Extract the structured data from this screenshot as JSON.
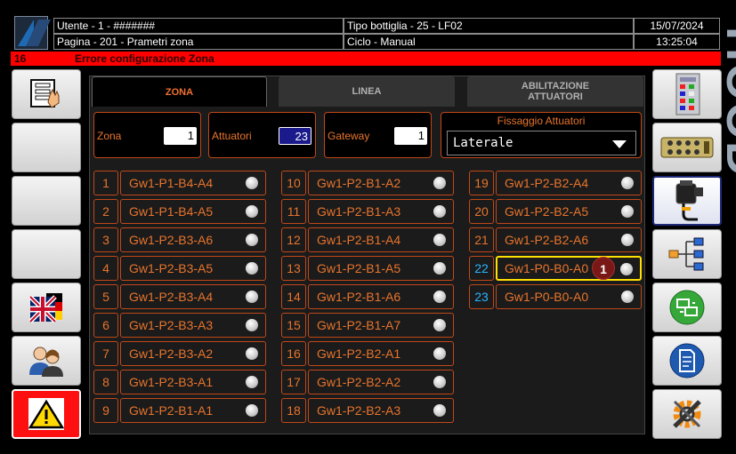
{
  "header": {
    "user": "Utente - 1 - #######",
    "bottle_type": "Tipo bottiglia - 25 - LF02",
    "date": "15/07/2024",
    "page": "Pagina - 201 - Prametri zona",
    "cycle": "Ciclo - Manual",
    "time": "13:25:04"
  },
  "error": {
    "code": "16",
    "message": "Errore configurazione Zona"
  },
  "side_text": "HOOD",
  "tabs": [
    {
      "label": "ZONA"
    },
    {
      "label": "LINEA"
    },
    {
      "label": "ABILITAZIONE ATTUATORI"
    }
  ],
  "settings": {
    "zona_label": "Zona",
    "zona_value": "1",
    "attuatori_label": "Attuatori",
    "attuatori_value": "23",
    "gateway_label": "Gateway",
    "gateway_value": "1",
    "fissaggio_label": "Fissaggio Attuatori",
    "fissaggio_value": "Laterale"
  },
  "actuators": [
    {
      "num": "1",
      "name": "Gw1-P1-B4-A4"
    },
    {
      "num": "2",
      "name": "Gw1-P1-B4-A5"
    },
    {
      "num": "3",
      "name": "Gw1-P2-B3-A6"
    },
    {
      "num": "4",
      "name": "Gw1-P2-B3-A5"
    },
    {
      "num": "5",
      "name": "Gw1-P2-B3-A4"
    },
    {
      "num": "6",
      "name": "Gw1-P2-B3-A3"
    },
    {
      "num": "7",
      "name": "Gw1-P2-B3-A2"
    },
    {
      "num": "8",
      "name": "Gw1-P2-B3-A1"
    },
    {
      "num": "9",
      "name": "Gw1-P2-B1-A1"
    },
    {
      "num": "10",
      "name": "Gw1-P2-B1-A2"
    },
    {
      "num": "11",
      "name": "Gw1-P2-B1-A3"
    },
    {
      "num": "12",
      "name": "Gw1-P2-B1-A4"
    },
    {
      "num": "13",
      "name": "Gw1-P2-B1-A5"
    },
    {
      "num": "14",
      "name": "Gw1-P2-B1-A6"
    },
    {
      "num": "15",
      "name": "Gw1-P2-B1-A7"
    },
    {
      "num": "16",
      "name": "Gw1-P2-B2-A1"
    },
    {
      "num": "17",
      "name": "Gw1-P2-B2-A2"
    },
    {
      "num": "18",
      "name": "Gw1-P2-B2-A3"
    },
    {
      "num": "19",
      "name": "Gw1-P2-B2-A4"
    },
    {
      "num": "20",
      "name": "Gw1-P2-B2-A5"
    },
    {
      "num": "21",
      "name": "Gw1-P2-B2-A6"
    },
    {
      "num": "22",
      "name": "Gw1-P0-B0-A0",
      "badge": "1"
    },
    {
      "num": "23",
      "name": "Gw1-P0-B0-A0"
    }
  ],
  "colors": {
    "accent": "#e8742c",
    "error": "#ff0000",
    "highlight": "#ffe000",
    "blue_number": "#2ab4ff"
  }
}
